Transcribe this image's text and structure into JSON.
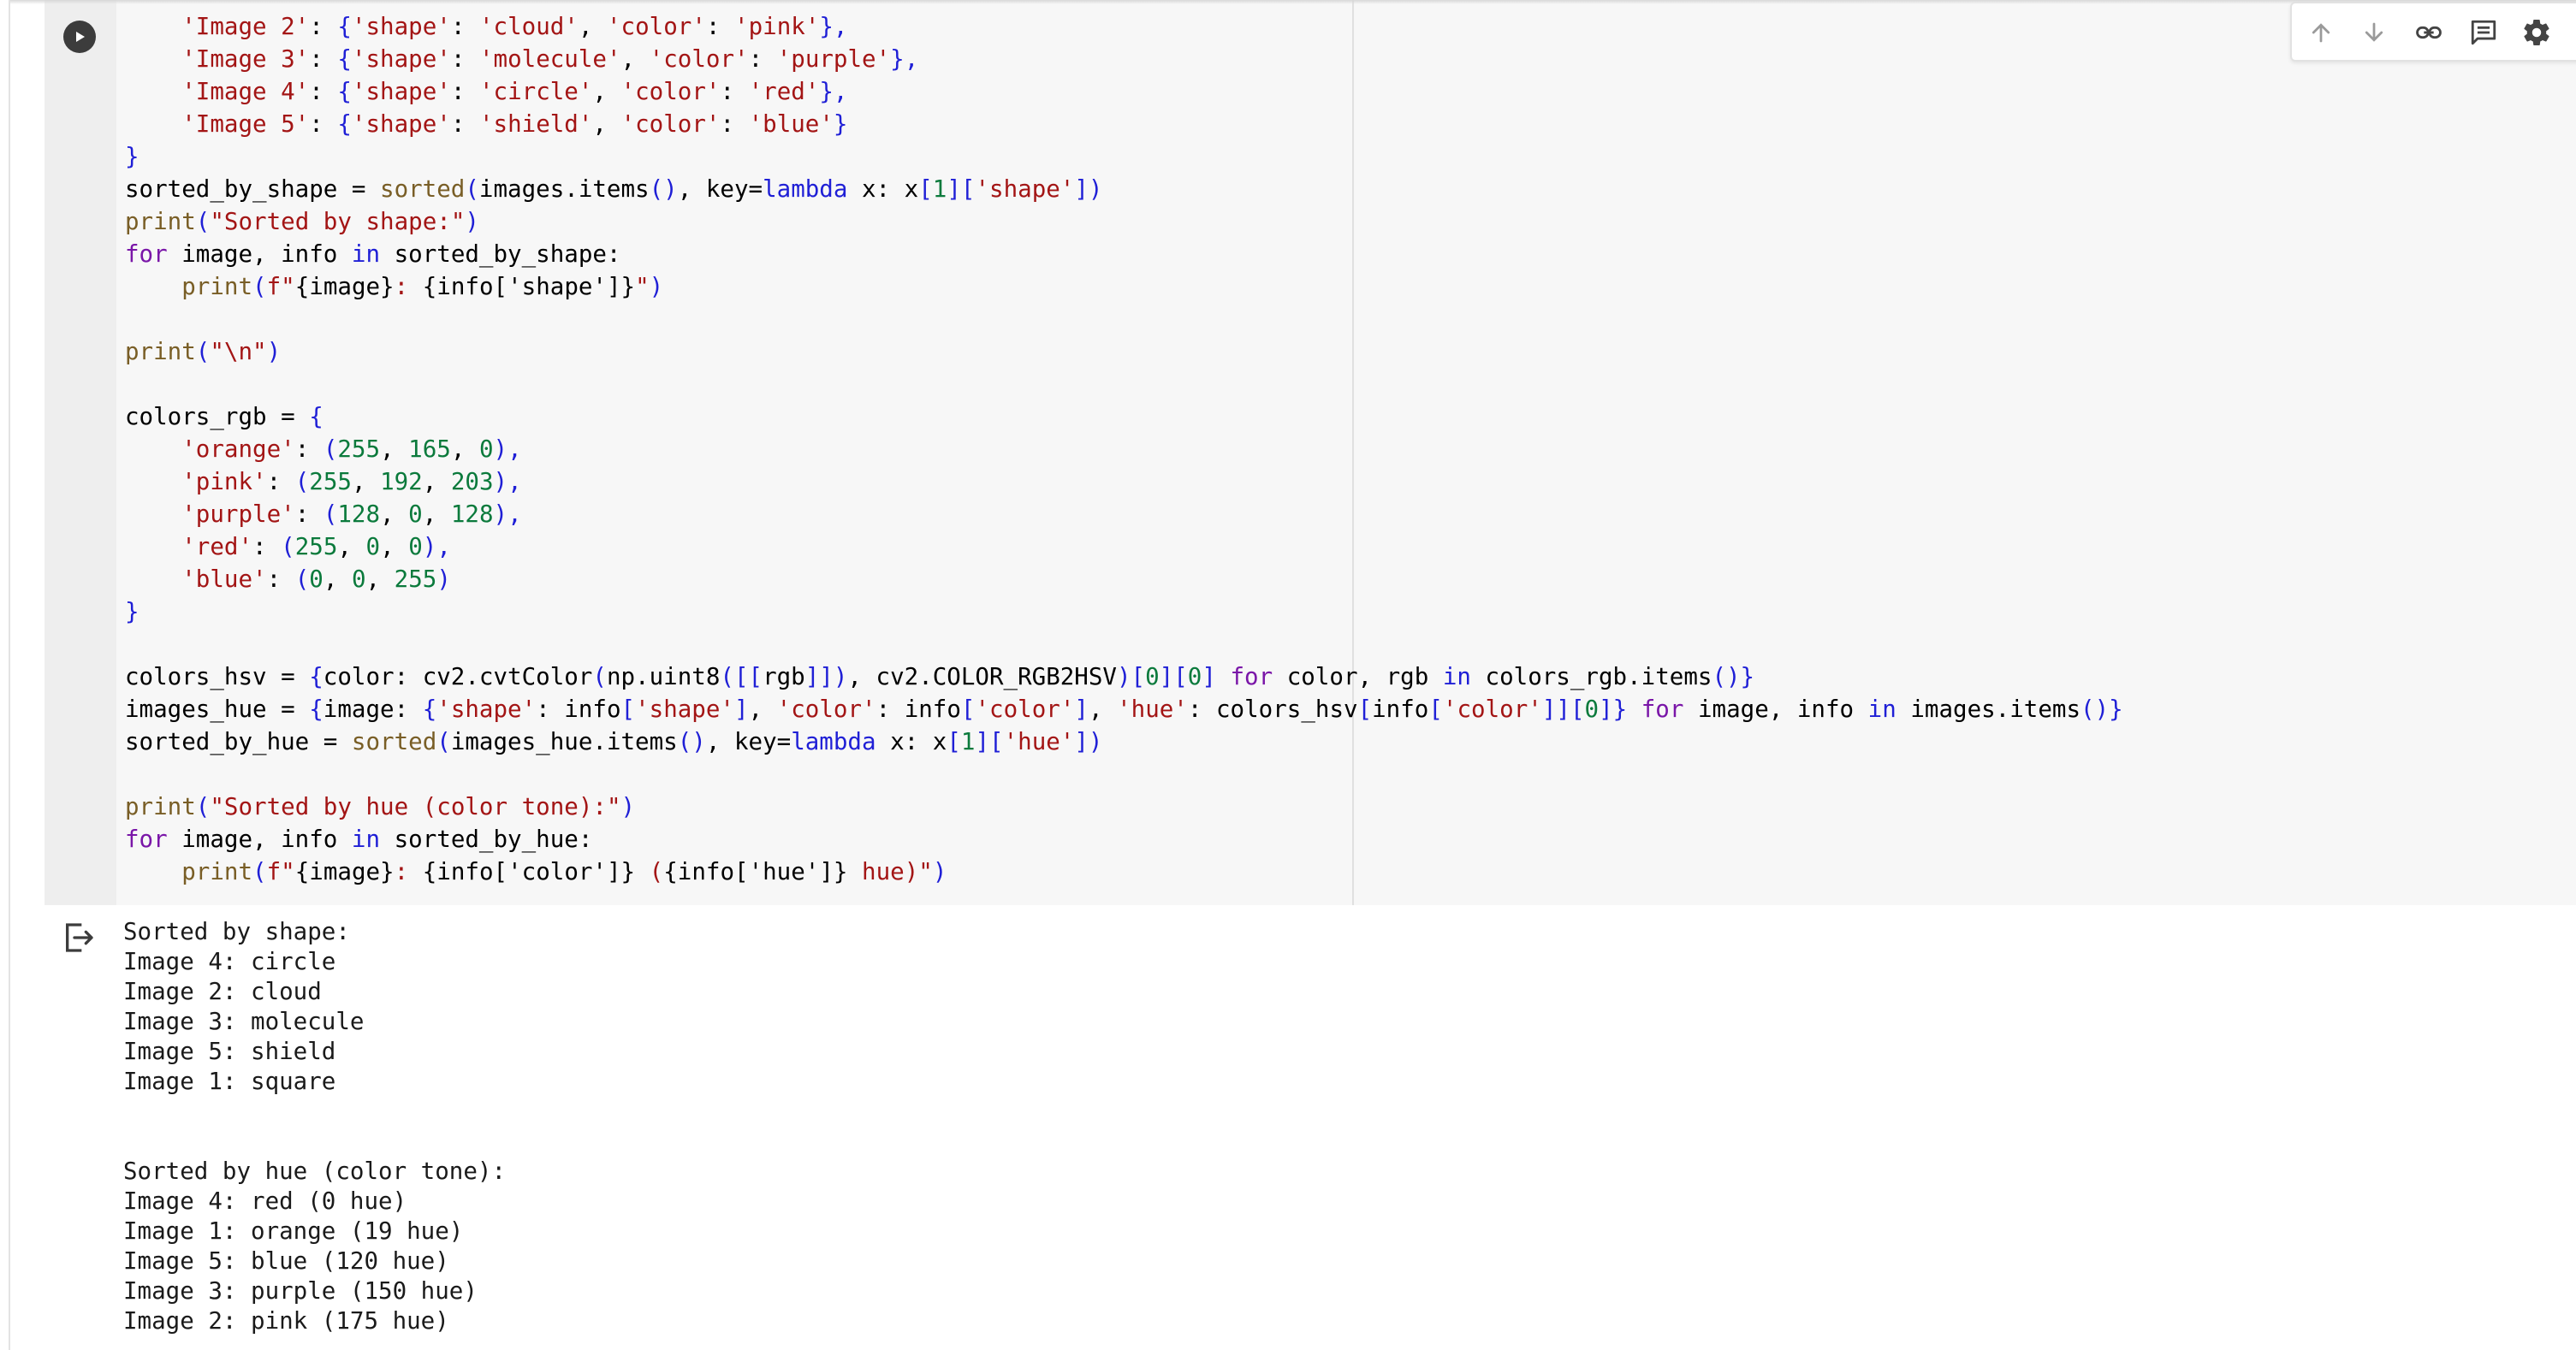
{
  "cell": {
    "code_lines": [
      [
        [
          "    ",
          ""
        ],
        [
          "'Image 2'",
          "s"
        ],
        [
          ": ",
          ""
        ],
        [
          "{",
          "b"
        ],
        [
          "'shape'",
          "s"
        ],
        [
          ": ",
          ""
        ],
        [
          "'cloud'",
          "s"
        ],
        [
          ", ",
          ""
        ],
        [
          "'color'",
          "s"
        ],
        [
          ": ",
          ""
        ],
        [
          "'pink'",
          "s"
        ],
        [
          "},",
          "b"
        ]
      ],
      [
        [
          "    ",
          ""
        ],
        [
          "'Image 3'",
          "s"
        ],
        [
          ": ",
          ""
        ],
        [
          "{",
          "b"
        ],
        [
          "'shape'",
          "s"
        ],
        [
          ": ",
          ""
        ],
        [
          "'molecule'",
          "s"
        ],
        [
          ", ",
          ""
        ],
        [
          "'color'",
          "s"
        ],
        [
          ": ",
          ""
        ],
        [
          "'purple'",
          "s"
        ],
        [
          "},",
          "b"
        ]
      ],
      [
        [
          "    ",
          ""
        ],
        [
          "'Image 4'",
          "s"
        ],
        [
          ": ",
          ""
        ],
        [
          "{",
          "b"
        ],
        [
          "'shape'",
          "s"
        ],
        [
          ": ",
          ""
        ],
        [
          "'circle'",
          "s"
        ],
        [
          ", ",
          ""
        ],
        [
          "'color'",
          "s"
        ],
        [
          ": ",
          ""
        ],
        [
          "'red'",
          "s"
        ],
        [
          "},",
          "b"
        ]
      ],
      [
        [
          "    ",
          ""
        ],
        [
          "'Image 5'",
          "s"
        ],
        [
          ": ",
          ""
        ],
        [
          "{",
          "b"
        ],
        [
          "'shape'",
          "s"
        ],
        [
          ": ",
          ""
        ],
        [
          "'shield'",
          "s"
        ],
        [
          ", ",
          ""
        ],
        [
          "'color'",
          "s"
        ],
        [
          ": ",
          ""
        ],
        [
          "'blue'",
          "s"
        ],
        [
          "}",
          "b"
        ]
      ],
      [
        [
          "}",
          "b"
        ]
      ],
      [
        [
          "sorted_by_shape = ",
          ""
        ],
        [
          "sorted",
          "f"
        ],
        [
          "(",
          "b"
        ],
        [
          "images.items",
          ""
        ],
        [
          "()",
          "b"
        ],
        [
          ", key=",
          ""
        ],
        [
          "lambda",
          "k"
        ],
        [
          " x: x",
          ""
        ],
        [
          "[",
          "b"
        ],
        [
          "1",
          "n"
        ],
        [
          "]",
          "b"
        ],
        [
          "[",
          "b"
        ],
        [
          "'shape'",
          "s"
        ],
        [
          "])",
          "b"
        ]
      ],
      [
        [
          "print",
          "f"
        ],
        [
          "(",
          "b"
        ],
        [
          "\"Sorted by shape:\"",
          "s"
        ],
        [
          ")",
          "b"
        ]
      ],
      [
        [
          "for",
          "p"
        ],
        [
          " image, info ",
          ""
        ],
        [
          "in",
          "k"
        ],
        [
          " sorted_by_shape:",
          ""
        ]
      ],
      [
        [
          "    ",
          ""
        ],
        [
          "print",
          "f"
        ],
        [
          "(",
          "b"
        ],
        [
          "f\"",
          "s"
        ],
        [
          "{image}",
          ""
        ],
        [
          ": ",
          "s"
        ],
        [
          "{info['shape']}",
          ""
        ],
        [
          "\"",
          "s"
        ],
        [
          ")",
          "b"
        ]
      ],
      [
        [
          "",
          ""
        ]
      ],
      [
        [
          "print",
          "f"
        ],
        [
          "(",
          "b"
        ],
        [
          "\"\\n\"",
          "s"
        ],
        [
          ")",
          "b"
        ]
      ],
      [
        [
          "",
          ""
        ]
      ],
      [
        [
          "colors_rgb = ",
          ""
        ],
        [
          "{",
          "b"
        ]
      ],
      [
        [
          "    ",
          ""
        ],
        [
          "'orange'",
          "s"
        ],
        [
          ": ",
          ""
        ],
        [
          "(",
          "b"
        ],
        [
          "255",
          "n"
        ],
        [
          ", ",
          ""
        ],
        [
          "165",
          "n"
        ],
        [
          ", ",
          ""
        ],
        [
          "0",
          "n"
        ],
        [
          "),",
          "b"
        ]
      ],
      [
        [
          "    ",
          ""
        ],
        [
          "'pink'",
          "s"
        ],
        [
          ": ",
          ""
        ],
        [
          "(",
          "b"
        ],
        [
          "255",
          "n"
        ],
        [
          ", ",
          ""
        ],
        [
          "192",
          "n"
        ],
        [
          ", ",
          ""
        ],
        [
          "203",
          "n"
        ],
        [
          "),",
          "b"
        ]
      ],
      [
        [
          "    ",
          ""
        ],
        [
          "'purple'",
          "s"
        ],
        [
          ": ",
          ""
        ],
        [
          "(",
          "b"
        ],
        [
          "128",
          "n"
        ],
        [
          ", ",
          ""
        ],
        [
          "0",
          "n"
        ],
        [
          ", ",
          ""
        ],
        [
          "128",
          "n"
        ],
        [
          "),",
          "b"
        ]
      ],
      [
        [
          "    ",
          ""
        ],
        [
          "'red'",
          "s"
        ],
        [
          ": ",
          ""
        ],
        [
          "(",
          "b"
        ],
        [
          "255",
          "n"
        ],
        [
          ", ",
          ""
        ],
        [
          "0",
          "n"
        ],
        [
          ", ",
          ""
        ],
        [
          "0",
          "n"
        ],
        [
          "),",
          "b"
        ]
      ],
      [
        [
          "    ",
          ""
        ],
        [
          "'blue'",
          "s"
        ],
        [
          ": ",
          ""
        ],
        [
          "(",
          "b"
        ],
        [
          "0",
          "n"
        ],
        [
          ", ",
          ""
        ],
        [
          "0",
          "n"
        ],
        [
          ", ",
          ""
        ],
        [
          "255",
          "n"
        ],
        [
          ")",
          "b"
        ]
      ],
      [
        [
          "}",
          "b"
        ]
      ],
      [
        [
          "",
          ""
        ]
      ],
      [
        [
          "colors_hsv = ",
          ""
        ],
        [
          "{",
          "b"
        ],
        [
          "color: cv2.cvtColor",
          ""
        ],
        [
          "(",
          "b"
        ],
        [
          "np.uint8",
          ""
        ],
        [
          "([[",
          "b"
        ],
        [
          "rgb",
          ""
        ],
        [
          "]])",
          "b"
        ],
        [
          ", cv2.COLOR_RGB2HSV",
          ""
        ],
        [
          ")[",
          "b"
        ],
        [
          "0",
          "n"
        ],
        [
          "][",
          "b"
        ],
        [
          "0",
          "n"
        ],
        [
          "]",
          "b"
        ],
        [
          " ",
          ""
        ],
        [
          "for",
          "p"
        ],
        [
          " color, rgb ",
          ""
        ],
        [
          "in",
          "k"
        ],
        [
          " colors_rgb.items",
          ""
        ],
        [
          "()}",
          "b"
        ]
      ],
      [
        [
          "images_hue = ",
          ""
        ],
        [
          "{",
          "b"
        ],
        [
          "image: ",
          ""
        ],
        [
          "{",
          "b"
        ],
        [
          "'shape'",
          "s"
        ],
        [
          ": info",
          ""
        ],
        [
          "[",
          "b"
        ],
        [
          "'shape'",
          "s"
        ],
        [
          "]",
          "b"
        ],
        [
          ", ",
          ""
        ],
        [
          "'color'",
          "s"
        ],
        [
          ": info",
          ""
        ],
        [
          "[",
          "b"
        ],
        [
          "'color'",
          "s"
        ],
        [
          "]",
          "b"
        ],
        [
          ", ",
          ""
        ],
        [
          "'hue'",
          "s"
        ],
        [
          ": colors_hsv",
          ""
        ],
        [
          "[",
          "b"
        ],
        [
          "info",
          ""
        ],
        [
          "[",
          "b"
        ],
        [
          "'color'",
          "s"
        ],
        [
          "]][",
          "b"
        ],
        [
          "0",
          "n"
        ],
        [
          "]}",
          "b"
        ],
        [
          " ",
          ""
        ],
        [
          "for",
          "p"
        ],
        [
          " image, info ",
          ""
        ],
        [
          "in",
          "k"
        ],
        [
          " images.items",
          ""
        ],
        [
          "()}",
          "b"
        ]
      ],
      [
        [
          "sorted_by_hue = ",
          ""
        ],
        [
          "sorted",
          "f"
        ],
        [
          "(",
          "b"
        ],
        [
          "images_hue.items",
          ""
        ],
        [
          "()",
          "b"
        ],
        [
          ", key=",
          ""
        ],
        [
          "lambda",
          "k"
        ],
        [
          " x: x",
          ""
        ],
        [
          "[",
          "b"
        ],
        [
          "1",
          "n"
        ],
        [
          "]",
          "b"
        ],
        [
          "[",
          "b"
        ],
        [
          "'hue'",
          "s"
        ],
        [
          "])",
          "b"
        ]
      ],
      [
        [
          "",
          ""
        ]
      ],
      [
        [
          "print",
          "f"
        ],
        [
          "(",
          "b"
        ],
        [
          "\"Sorted by hue (color tone):\"",
          "s"
        ],
        [
          ")",
          "b"
        ]
      ],
      [
        [
          "for",
          "p"
        ],
        [
          " image, info ",
          ""
        ],
        [
          "in",
          "k"
        ],
        [
          " sorted_by_hue:",
          ""
        ]
      ],
      [
        [
          "    ",
          ""
        ],
        [
          "print",
          "f"
        ],
        [
          "(",
          "b"
        ],
        [
          "f\"",
          "s"
        ],
        [
          "{image}",
          ""
        ],
        [
          ": ",
          "s"
        ],
        [
          "{info['color']}",
          ""
        ],
        [
          " (",
          "s"
        ],
        [
          "{info['hue']}",
          ""
        ],
        [
          " hue)\"",
          "s"
        ],
        [
          ")",
          "b"
        ]
      ]
    ]
  },
  "output": {
    "lines": [
      "Sorted by shape:",
      "Image 4: circle",
      "Image 2: cloud",
      "Image 3: molecule",
      "Image 5: shield",
      "Image 1: square",
      "",
      "",
      "Sorted by hue (color tone):",
      "Image 4: red (0 hue)",
      "Image 1: orange (19 hue)",
      "Image 5: blue (120 hue)",
      "Image 3: purple (150 hue)",
      "Image 2: pink (175 hue)"
    ]
  },
  "toolbar": {
    "icons": [
      "arrow-up-icon",
      "arrow-down-icon",
      "link-icon",
      "comment-icon",
      "gear-icon"
    ]
  },
  "colors": {
    "keyword": "#1f1fd6",
    "keyword_for": "#7a16a8",
    "string": "#a31515",
    "number": "#0b7a3c",
    "builtin": "#795e26",
    "gutter": "#eeeeee",
    "editor_bg": "#f7f7f7"
  }
}
